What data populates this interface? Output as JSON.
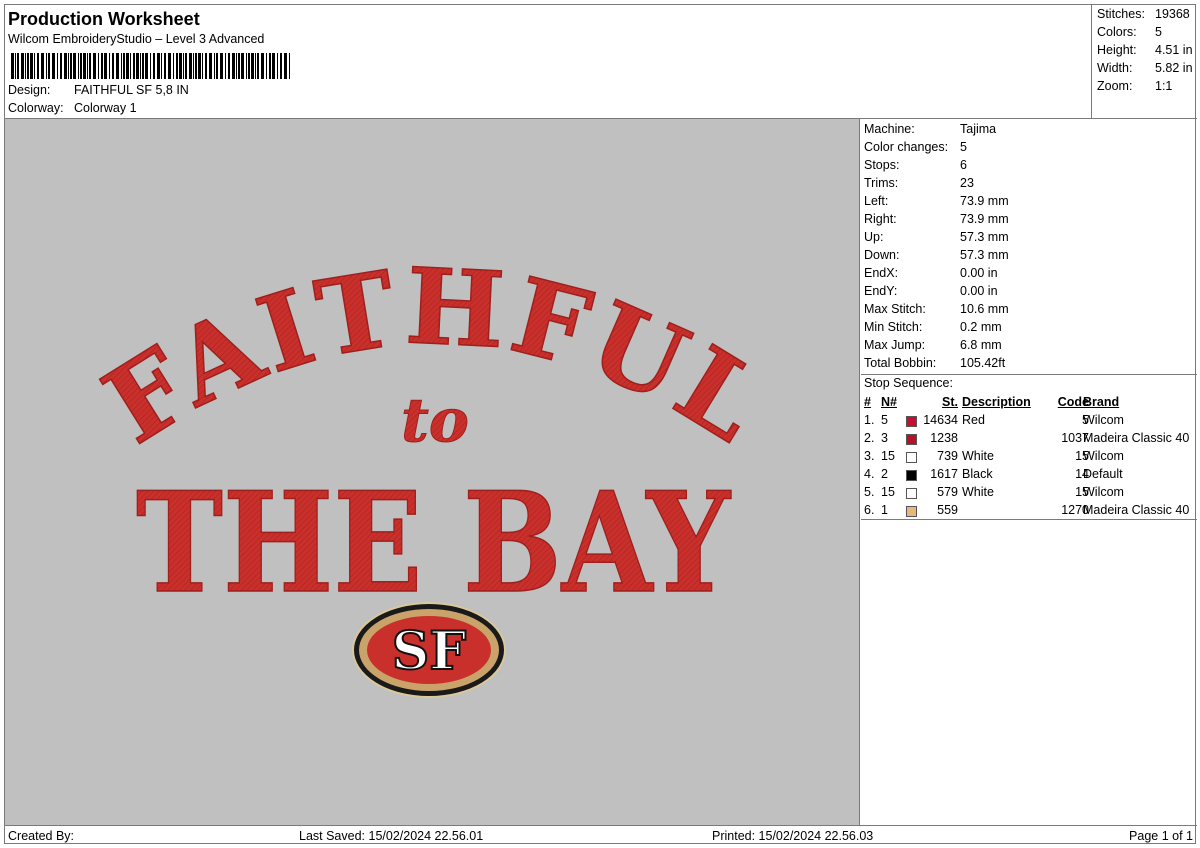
{
  "header": {
    "title": "Production Worksheet",
    "subtitle": "Wilcom EmbroideryStudio – Level 3 Advanced",
    "design_label": "Design:",
    "design_value": "FAITHFUL SF 5,8 IN",
    "colorway_label": "Colorway:",
    "colorway_value": "Colorway 1"
  },
  "summary": {
    "stitches_label": "Stitches:",
    "stitches_value": "19368",
    "colors_label": "Colors:",
    "colors_value": "5",
    "height_label": "Height:",
    "height_value": "4.51 in",
    "width_label": "Width:",
    "width_value": "5.82 in",
    "zoom_label": "Zoom:",
    "zoom_value": "1:1"
  },
  "design": {
    "line1": "FAITHFUL",
    "line2": "to",
    "line3": "THE BAY",
    "logo": "SF",
    "thread_red": "#c9302c",
    "background": "#c0c0c0"
  },
  "info": {
    "machine_label": "Machine:",
    "machine_value": "Tajima",
    "color_changes_label": "Color changes:",
    "color_changes_value": "5",
    "stops_label": "Stops:",
    "stops_value": "6",
    "trims_label": "Trims:",
    "trims_value": "23",
    "left_label": "Left:",
    "left_value": "73.9 mm",
    "right_label": "Right:",
    "right_value": "73.9 mm",
    "up_label": "Up:",
    "up_value": "57.3 mm",
    "down_label": "Down:",
    "down_value": "57.3 mm",
    "endx_label": "EndX:",
    "endx_value": "0.00 in",
    "endy_label": "EndY:",
    "endy_value": "0.00 in",
    "max_stitch_label": "Max Stitch:",
    "max_stitch_value": "10.6 mm",
    "min_stitch_label": "Min Stitch:",
    "min_stitch_value": "0.2 mm",
    "max_jump_label": "Max Jump:",
    "max_jump_value": "6.8 mm",
    "total_bobbin_label": "Total Bobbin:",
    "total_bobbin_value": "105.42ft"
  },
  "stop_sequence": {
    "title": "Stop Sequence:",
    "headers": {
      "num": "#",
      "n": "N#",
      "st": "St.",
      "description": "Description",
      "code": "Code",
      "brand": "Brand"
    },
    "rows": [
      {
        "num": "1.",
        "n": "5",
        "color": "#c8102e",
        "st": "14634",
        "description": "Red",
        "code": "5",
        "brand": "Wilcom"
      },
      {
        "num": "2.",
        "n": "3",
        "color": "#b5122a",
        "st": "1238",
        "description": "",
        "code": "1037",
        "brand": "Madeira Classic 40"
      },
      {
        "num": "3.",
        "n": "15",
        "color": "#ffffff",
        "st": "739",
        "description": "White",
        "code": "15",
        "brand": "Wilcom"
      },
      {
        "num": "4.",
        "n": "2",
        "color": "#000000",
        "st": "1617",
        "description": "Black",
        "code": "14",
        "brand": "Default"
      },
      {
        "num": "5.",
        "n": "15",
        "color": "#ffffff",
        "st": "579",
        "description": "White",
        "code": "15",
        "brand": "Wilcom"
      },
      {
        "num": "6.",
        "n": "1",
        "color": "#e8b77e",
        "st": "559",
        "description": "",
        "code": "1270",
        "brand": "Madeira Classic 40"
      }
    ]
  },
  "footer": {
    "created_by": "Created By:",
    "last_saved": "Last Saved: 15/02/2024 22.56.01",
    "printed": "Printed: 15/02/2024 22.56.03",
    "page": "Page 1 of 1"
  }
}
